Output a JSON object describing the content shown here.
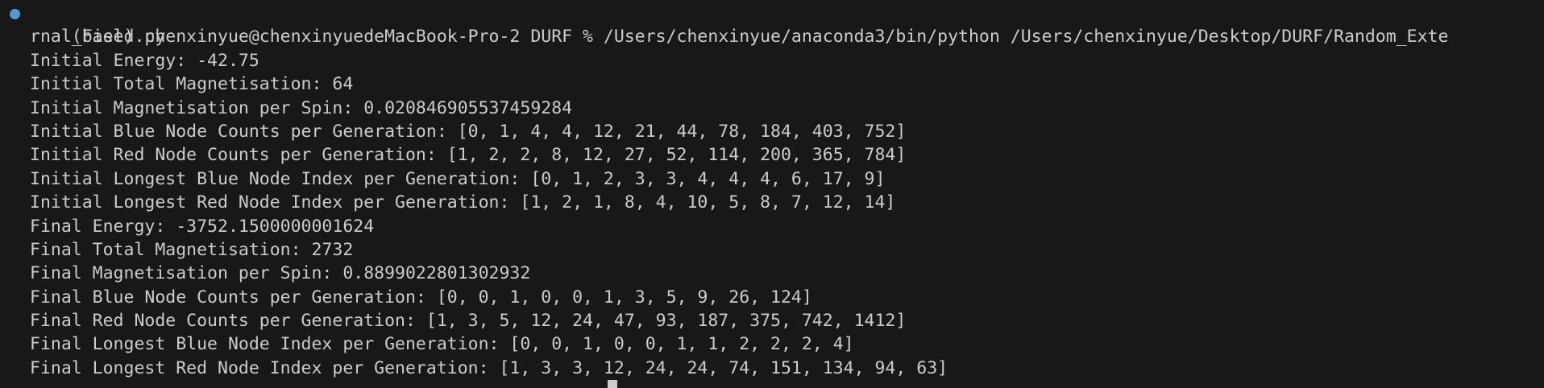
{
  "colors": {
    "background": "#181818",
    "text": "#cccccc",
    "status_dot": "#4d9ad6"
  },
  "terminal": {
    "command_line": "(base) chenxinyue@chenxinyuedeMacBook-Pro-2 DURF % /Users/chenxinyue/anaconda3/bin/python /Users/chenxinyue/Desktop/DURF/Random_Exte",
    "command_wrap": "rnal_Field.py",
    "output": [
      "Initial Energy: -42.75",
      "Initial Total Magnetisation: 64",
      "Initial Magnetisation per Spin: 0.020846905537459284",
      "Initial Blue Node Counts per Generation: [0, 1, 4, 4, 12, 21, 44, 78, 184, 403, 752]",
      "Initial Red Node Counts per Generation: [1, 2, 2, 8, 12, 27, 52, 114, 200, 365, 784]",
      "Initial Longest Blue Node Index per Generation: [0, 1, 2, 3, 3, 4, 4, 4, 6, 17, 9]",
      "Initial Longest Red Node Index per Generation: [1, 2, 1, 8, 4, 10, 5, 8, 7, 12, 14]",
      "Final Energy: -3752.1500000001624",
      "Final Total Magnetisation: 2732",
      "Final Magnetisation per Spin: 0.8899022801302932",
      "Final Blue Node Counts per Generation: [0, 0, 1, 0, 0, 1, 3, 5, 9, 26, 124]",
      "Final Red Node Counts per Generation: [1, 3, 5, 12, 24, 47, 93, 187, 375, 742, 1412]",
      "Final Longest Blue Node Index per Generation: [0, 0, 1, 0, 0, 1, 1, 2, 2, 2, 4]",
      "Final Longest Red Node Index per Generation: [1, 3, 3, 12, 24, 24, 74, 151, 134, 94, 63]"
    ]
  }
}
